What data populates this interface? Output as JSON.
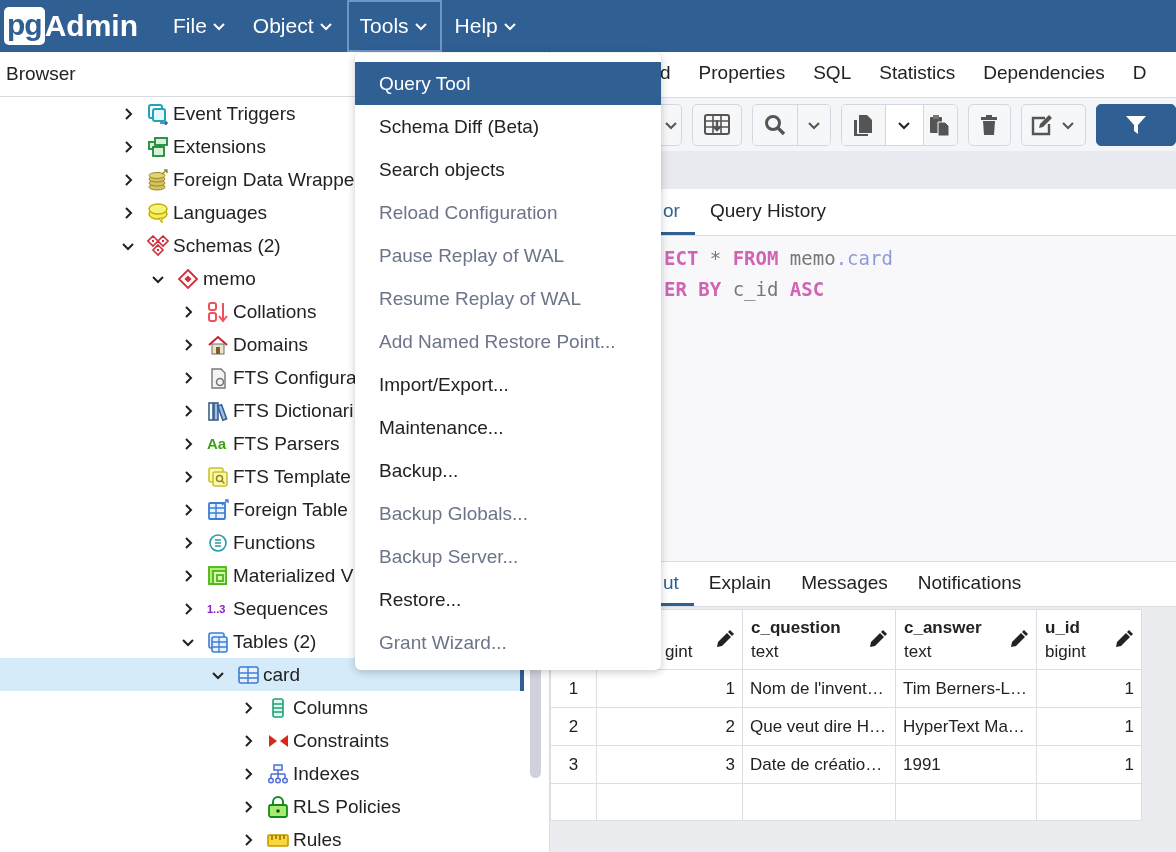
{
  "app": {
    "logo_mark": "pg",
    "logo_text": "Admin"
  },
  "menu_bar": [
    {
      "label": "File",
      "selected": false
    },
    {
      "label": "Object",
      "selected": false
    },
    {
      "label": "Tools",
      "selected": true
    },
    {
      "label": "Help",
      "selected": false
    }
  ],
  "tools_menu": [
    {
      "label": "Query Tool",
      "selected": true,
      "disabled": false
    },
    {
      "label": "Schema Diff (Beta)",
      "selected": false,
      "disabled": false
    },
    {
      "label": "Search objects",
      "selected": false,
      "disabled": false
    },
    {
      "label": "Reload Configuration",
      "selected": false,
      "disabled": true
    },
    {
      "label": "Pause Replay of WAL",
      "selected": false,
      "disabled": true
    },
    {
      "label": "Resume Replay of WAL",
      "selected": false,
      "disabled": true
    },
    {
      "label": "Add Named Restore Point...",
      "selected": false,
      "disabled": true
    },
    {
      "label": "Import/Export...",
      "selected": false,
      "disabled": false
    },
    {
      "label": "Maintenance...",
      "selected": false,
      "disabled": false
    },
    {
      "label": "Backup...",
      "selected": false,
      "disabled": false
    },
    {
      "label": "Backup Globals...",
      "selected": false,
      "disabled": true
    },
    {
      "label": "Backup Server...",
      "selected": false,
      "disabled": true
    },
    {
      "label": "Restore...",
      "selected": false,
      "disabled": false
    },
    {
      "label": "Grant Wizard...",
      "selected": false,
      "disabled": true
    }
  ],
  "browser": {
    "title": "Browser",
    "tree": [
      {
        "label": "Event Triggers",
        "kind": "trigger",
        "expanded": false,
        "selected": false
      },
      {
        "label": "Extensions",
        "kind": "extension",
        "expanded": false,
        "selected": false
      },
      {
        "label": "Foreign Data Wrappe",
        "kind": "wrapper",
        "expanded": false,
        "selected": false
      },
      {
        "label": "Languages",
        "kind": "language",
        "expanded": false,
        "selected": false
      },
      {
        "label": "Schemas (2)",
        "kind": "schemas",
        "expanded": true,
        "selected": false,
        "children": [
          {
            "label": "memo",
            "kind": "schema",
            "expanded": true,
            "selected": false,
            "children": [
              {
                "label": "Collations",
                "kind": "collation",
                "expanded": false,
                "selected": false
              },
              {
                "label": "Domains",
                "kind": "domain",
                "expanded": false,
                "selected": false
              },
              {
                "label": "FTS Configura",
                "kind": "ftsconfig",
                "expanded": false,
                "selected": false
              },
              {
                "label": "FTS Dictionari",
                "kind": "dictionary",
                "expanded": false,
                "selected": false
              },
              {
                "label": "FTS Parsers",
                "kind": "parser",
                "glyph": "Aa",
                "expanded": false,
                "selected": false
              },
              {
                "label": "FTS Template",
                "kind": "template",
                "expanded": false,
                "selected": false
              },
              {
                "label": "Foreign Table",
                "kind": "foreigntable",
                "expanded": false,
                "selected": false
              },
              {
                "label": "Functions",
                "kind": "function",
                "expanded": false,
                "selected": false
              },
              {
                "label": "Materialized V",
                "kind": "matview",
                "expanded": false,
                "selected": false
              },
              {
                "label": "Sequences",
                "kind": "sequence",
                "glyph": "1..3",
                "expanded": false,
                "selected": false
              },
              {
                "label": "Tables (2)",
                "kind": "tables",
                "expanded": true,
                "selected": false,
                "children": [
                  {
                    "label": "card",
                    "kind": "table",
                    "expanded": true,
                    "selected": true,
                    "children": [
                      {
                        "label": "Columns",
                        "kind": "columns",
                        "expanded": false,
                        "selected": false
                      },
                      {
                        "label": "Constraints",
                        "kind": "constraints",
                        "expanded": false,
                        "selected": false
                      },
                      {
                        "label": "Indexes",
                        "kind": "indexes",
                        "expanded": false,
                        "selected": false
                      },
                      {
                        "label": "RLS Policies",
                        "kind": "policies",
                        "expanded": false,
                        "selected": false
                      },
                      {
                        "label": "Rules",
                        "kind": "rules",
                        "expanded": false,
                        "selected": false
                      }
                    ]
                  }
                ]
              }
            ]
          }
        ]
      }
    ]
  },
  "detail_tabs": [
    {
      "label": "d"
    },
    {
      "label": "Properties"
    },
    {
      "label": "SQL"
    },
    {
      "label": "Statistics"
    },
    {
      "label": "Dependencies"
    },
    {
      "label": "D"
    }
  ],
  "editor_tabs": [
    {
      "label": "or",
      "selected": true
    },
    {
      "label": "Query History",
      "selected": false
    }
  ],
  "code_lines": [
    [
      {
        "text": "ECT",
        "kind": "keyword"
      },
      {
        "text": " * ",
        "kind": "operator"
      },
      {
        "text": "FROM",
        "kind": "keyword"
      },
      {
        "text": " memo",
        "kind": "name"
      },
      {
        "text": ".card",
        "kind": "property"
      }
    ],
    [
      {
        "text": "ER BY",
        "kind": "keyword"
      },
      {
        "text": " c_id ",
        "kind": "name"
      },
      {
        "text": "ASC",
        "kind": "keyword"
      }
    ]
  ],
  "result_tabs": [
    {
      "label": "ut",
      "selected": true
    },
    {
      "label": "Explain",
      "selected": false
    },
    {
      "label": "Messages",
      "selected": false
    },
    {
      "label": "Notifications",
      "selected": false
    }
  ],
  "grid": {
    "columns": [
      {
        "type": "gint",
        "kind": "number"
      },
      {
        "name": "c_question",
        "type": "text",
        "kind": "text"
      },
      {
        "name": "c_answer",
        "type": "text",
        "kind": "text"
      },
      {
        "name": "u_id",
        "type": "bigint",
        "kind": "number"
      }
    ],
    "rows": [
      {
        "number": "1",
        "cells": [
          "1",
          "Nom de l'invent…",
          "Tim Berners-L…",
          "1"
        ]
      },
      {
        "number": "2",
        "cells": [
          "2",
          "Que veut dire H…",
          "HyperText Ma…",
          "1"
        ]
      },
      {
        "number": "3",
        "cells": [
          "3",
          "Date de créatio…",
          "1991",
          "1"
        ]
      }
    ]
  }
}
